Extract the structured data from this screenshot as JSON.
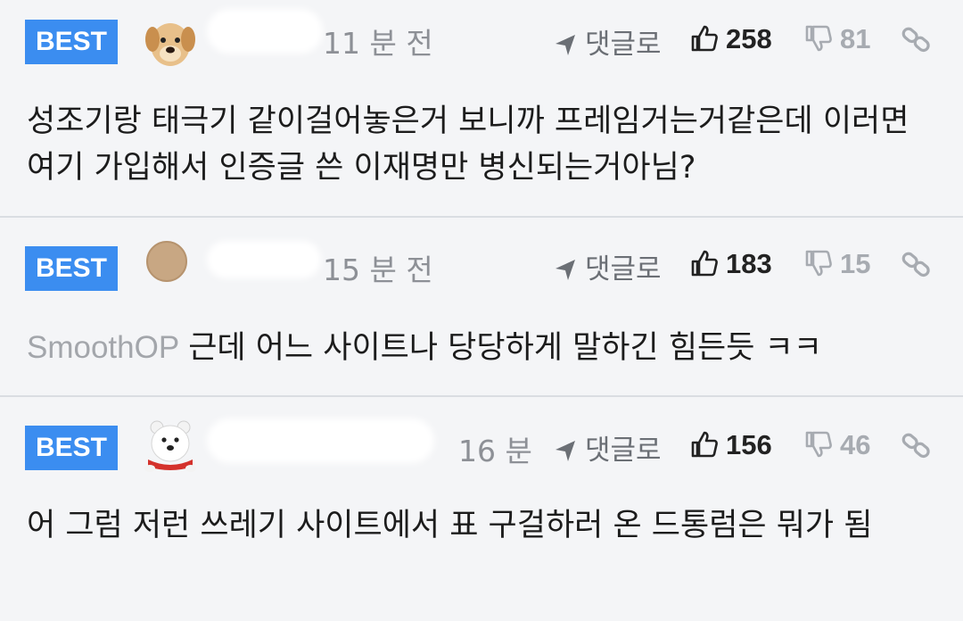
{
  "comments": [
    {
      "badge": "BEST",
      "avatar": "puppy-avatar",
      "time": "11 분 전",
      "reply_label": "댓글로",
      "likes": "258",
      "dislikes": "81",
      "text": "성조기랑 태극기 같이걸어놓은거 보니까 프레임거는거같은데 이러면 여기 가입해서 인증글 쓴 이재명만 병신되는거아님?"
    },
    {
      "badge": "BEST",
      "avatar": "beige-circle-avatar",
      "time": "15 분 전",
      "reply_label": "댓글로",
      "likes": "183",
      "dislikes": "15",
      "mention": "SmoothOP",
      "text": "근데 어느 사이트나 당당하게 말하긴 힘든듯 ㅋㅋ"
    },
    {
      "badge": "BEST",
      "avatar": "polar-bear-avatar",
      "time": "16 분",
      "reply_label": "댓글로",
      "likes": "156",
      "dislikes": "46",
      "text": "어 그럼 저런 쓰레기 사이트에서 표 구걸하러 온 드통럼은 뭐가 됨"
    }
  ],
  "colors": {
    "badge": "#3b8df0",
    "muted": "#a7abb1",
    "background": "#f4f5f7"
  }
}
